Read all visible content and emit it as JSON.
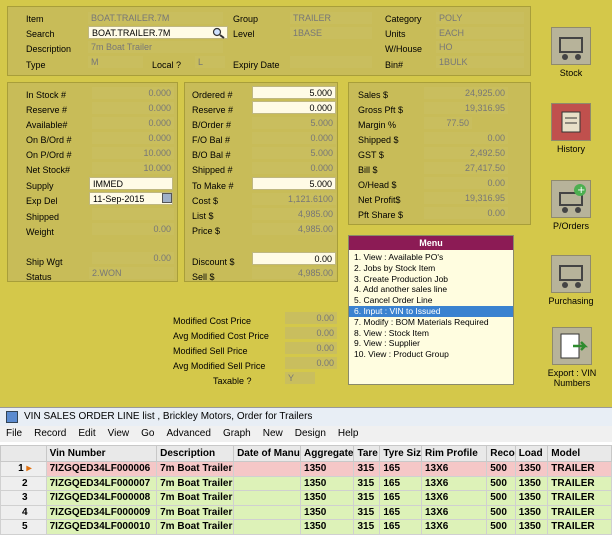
{
  "header": {
    "item_label": "Item",
    "item_value": "BOAT.TRAILER.7M",
    "group_label": "Group",
    "group_value": "TRAILER",
    "category_label": "Category",
    "category_value": "POLY",
    "search_label": "Search",
    "search_value": "BOAT.TRAILER.7M",
    "level_label": "Level",
    "level_value": "1BASE",
    "units_label": "Units",
    "units_value": "EACH",
    "description_label": "Description",
    "description_value": "7m Boat Trailer",
    "whouse_label": "W/House",
    "whouse_value": "HO",
    "type_label": "Type",
    "type_value": "M",
    "local_label": "Local ?",
    "local_value": "L",
    "expiry_label": "Expiry Date",
    "bin_label": "Bin#",
    "bin_value": "1BULK"
  },
  "stock_left": {
    "in_stock_label": "In Stock #",
    "in_stock": "0.000",
    "reserve_label": "Reserve #",
    "reserve": "0.000",
    "available_label": "Available#",
    "available": "0.000",
    "on_bord_label": "On B/Ord #",
    "on_bord": "0.000",
    "on_pord_label": "On P/Ord #",
    "on_pord": "10.000",
    "net_stock_label": "Net Stock#",
    "net_stock": "10.000",
    "supply_label": "Supply",
    "supply": "IMMED",
    "expdel_label": "Exp Del",
    "expdel": "11-Sep-2015",
    "shipped_label": "Shipped",
    "weight_label": "Weight",
    "weight": "0.00",
    "ship_wgt_label": "Ship Wgt",
    "ship_wgt": "0.00",
    "status_label": "Status",
    "status": "2.WON"
  },
  "stock_mid": {
    "ordered_label": "Ordered #",
    "ordered": "5.000",
    "reserve_label": "Reserve #",
    "reserve": "0.000",
    "border_label": "B/Order #",
    "border": "5.000",
    "fo_bal_label": "F/O Bal #",
    "fo_bal": "0.000",
    "bo_bal_label": "B/O Bal #",
    "bo_bal": "5.000",
    "shipped_label": "Shipped #",
    "shipped": "0.000",
    "to_make_label": "To Make #",
    "to_make": "5.000",
    "cost_label": "Cost  $",
    "cost": "1,121.6100",
    "list_label": "List  $",
    "list": "4,985.00",
    "price_label": "Price  $",
    "price": "4,985.00",
    "discount_label": "Discount $",
    "discount": "0.00",
    "sell_label": "Sell  $",
    "sell": "4,985.00"
  },
  "sales": {
    "sales_label": "Sales  $",
    "sales": "24,925.00",
    "gross_label": "Gross Pft $",
    "gross": "19,316.95",
    "margin_label": "Margin  %",
    "margin": "77.50",
    "shipped_label": "Shipped  $",
    "shipped": "0.00",
    "gst_label": "GST  $",
    "gst": "2,492.50",
    "bill_label": "Bill  $",
    "bill": "27,417.50",
    "ohead_label": "O/Head $",
    "ohead": "0.00",
    "net_label": "Net Profit$",
    "net": "19,316.95",
    "pft_label": "Pft Share $",
    "pft": "0.00"
  },
  "modified": {
    "mcp_label": "Modified Cost Price",
    "mcp": "0.00",
    "amcp_label": "Avg Modified Cost Price",
    "amcp": "0.00",
    "msp_label": "Modified Sell Price",
    "msp": "0.00",
    "amsp_label": "Avg Modified Sell Price",
    "amsp": "0.00",
    "taxable_label": "Taxable ?",
    "taxable": "Y"
  },
  "menu": {
    "title": "Menu",
    "items": [
      "1. View : Available PO's",
      "2. Jobs by Stock Item",
      "3. Create Production Job",
      "4. Add another sales line",
      "5. Cancel Order Line",
      "6. Input : VIN to Issued",
      "7. Modify : BOM Materials Required",
      "8. View : Stock Item",
      "9. View : Supplier",
      "10. View  : Product Group"
    ]
  },
  "side_buttons": {
    "stock": "Stock",
    "history": "History",
    "porders": "P/Orders",
    "purchasing": "Purchasing",
    "export_line1": "Export : VIN",
    "export_line2": "Numbers"
  },
  "window": {
    "title": "VIN SALES ORDER LINE list , Brickley Motors, Order for Trailers",
    "menus": [
      "File",
      "Record",
      "Edit",
      "View",
      "Go",
      "Advanced",
      "Graph",
      "New",
      "Design",
      "Help"
    ],
    "columns": [
      "Vin Number",
      "Description",
      "Date of Manu",
      "Aggregate",
      "Tare",
      "Tyre Siz",
      "Rim Profile",
      "Reco",
      "Load",
      "Model"
    ],
    "rows": [
      {
        "n": "1",
        "vin": "7IZGQED34LF000006",
        "desc": "7m Boat Trailer",
        "date": "",
        "agg": "1350",
        "tare": "315",
        "tyre": "165",
        "rim": "13X6",
        "reco": "500",
        "load": "1350",
        "model": "TRAILER"
      },
      {
        "n": "2",
        "vin": "7IZGQED34LF000007",
        "desc": "7m Boat Trailer",
        "date": "",
        "agg": "1350",
        "tare": "315",
        "tyre": "165",
        "rim": "13X6",
        "reco": "500",
        "load": "1350",
        "model": "TRAILER"
      },
      {
        "n": "3",
        "vin": "7IZGQED34LF000008",
        "desc": "7m Boat Trailer",
        "date": "",
        "agg": "1350",
        "tare": "315",
        "tyre": "165",
        "rim": "13X6",
        "reco": "500",
        "load": "1350",
        "model": "TRAILER"
      },
      {
        "n": "4",
        "vin": "7IZGQED34LF000009",
        "desc": "7m Boat Trailer",
        "date": "",
        "agg": "1350",
        "tare": "315",
        "tyre": "165",
        "rim": "13X6",
        "reco": "500",
        "load": "1350",
        "model": "TRAILER"
      },
      {
        "n": "5",
        "vin": "7IZGQED34LF000010",
        "desc": "7m Boat Trailer",
        "date": "",
        "agg": "1350",
        "tare": "315",
        "tyre": "165",
        "rim": "13X6",
        "reco": "500",
        "load": "1350",
        "model": "TRAILER"
      }
    ]
  }
}
